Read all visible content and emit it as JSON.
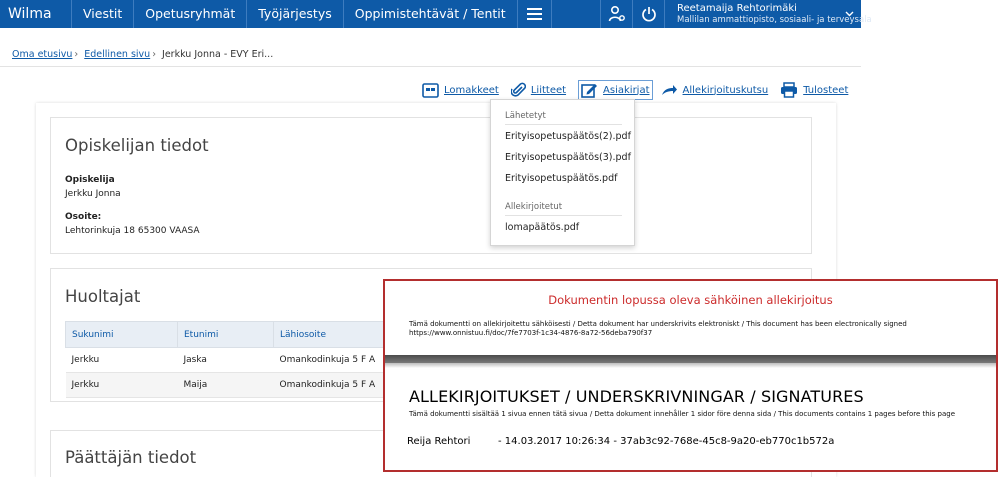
{
  "nav": {
    "logo": "Wilma",
    "items": [
      "Viestit",
      "Opetusryhmät",
      "Työjärjestys",
      "Oppimistehtävät / Tentit"
    ],
    "user_name": "Reetamaija Rehtorimäki",
    "user_org": "Mallilan ammattiopisto, sosiaali- ja terveysala"
  },
  "breadcrumb": {
    "home": "Oma etusivu",
    "previous": "Edellinen sivu",
    "current": "Jerkku Jonna - EVY Eri..."
  },
  "actions": {
    "forms": "Lomakkeet",
    "attachments": "Liitteet",
    "documents": "Asiakirjat",
    "signature_invite": "Allekirjoituskutsu",
    "printouts": "Tulosteet"
  },
  "dropdown": {
    "sent_header": "Lähetetyt",
    "sent_items": [
      "Erityisopetuspäätös(2).pdf",
      "Erityisopetuspäätös(3).pdf",
      "Erityisopetuspäätös.pdf"
    ],
    "signed_header": "Allekirjoitetut",
    "signed_items": [
      "lomapäätös.pdf"
    ]
  },
  "student": {
    "title": "Opiskelijan tiedot",
    "name_label": "Opiskelija",
    "name": "Jerkku Jonna",
    "address_label": "Osoite:",
    "address": "Lehtorinkuja 18 65300 VAASA"
  },
  "guardians": {
    "title": "Huoltajat",
    "columns": [
      "Sukunimi",
      "Etunimi",
      "Lähiosoite"
    ],
    "rows": [
      [
        "Jerkku",
        "Jaska",
        "Omankodinkuja 5 F A"
      ],
      [
        "Jerkku",
        "Maija",
        "Omankodinkuja 5 F A"
      ]
    ]
  },
  "decider": {
    "title": "Päättäjän tiedot"
  },
  "signature": {
    "caption": "Dokumentin lopussa oleva sähköinen allekirjoitus",
    "notice": "Tämä dokumentti on allekirjoitettu sähköisesti / Detta dokument har underskrivits elektroniskt / This document has been electronically signed",
    "url": "https://www.onnistuu.fi/doc/7fe7703f-1c34-4876-8a72-56deba790f37",
    "heading": "ALLEKIRJOITUKSET / UNDERSKRIVNINGAR / SIGNATURES",
    "pages_note": "Tämä dokumentti sisältää 1 sivua ennen tätä sivua / Detta dokument innehåller 1 sidor före denna sida / This documents contains 1 pages before this page",
    "signer": "Reija Rehtori",
    "details": "- 14.03.2017 10:26:34 - 37ab3c92-768e-45c8-9a20-eb770c1b572a"
  },
  "colors": {
    "nav_bg": "#0e5aa7",
    "link": "#0e5aa7",
    "signature_border": "#b32e2e",
    "signature_caption": "#cc2b2b"
  }
}
